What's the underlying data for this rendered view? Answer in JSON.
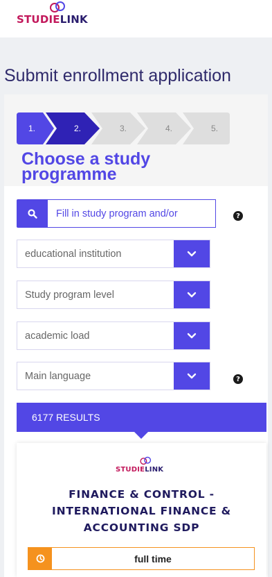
{
  "brand": {
    "logo_part1": "STUDIE",
    "logo_part2": "LINK"
  },
  "page": {
    "title": "Submit enrollment application"
  },
  "stepper": {
    "steps": [
      "1.",
      "2.",
      "3.",
      "4.",
      "5."
    ],
    "active_step": 2
  },
  "section": {
    "title": "Choose a study programme"
  },
  "search": {
    "placeholder": "Fill in study program and/or"
  },
  "filters": {
    "institution": "educational institution",
    "level": "Study program level",
    "load": "academic load",
    "language": "Main language"
  },
  "results": {
    "label": "6177 RESULTS"
  },
  "card": {
    "logo_part1": "STUDIE",
    "logo_part2": "LINK",
    "title": "FINANCE & CONTROL - INTERNATIONAL FINANCE & ACCOUNTING SDP",
    "badge_text": "full time",
    "badge_icon": "clock-icon"
  },
  "help_glyph": "?",
  "colors": {
    "primary": "#5247e5",
    "brand_pink": "#c2185b",
    "orange": "#f5921e",
    "navy": "#1f1a5e"
  }
}
